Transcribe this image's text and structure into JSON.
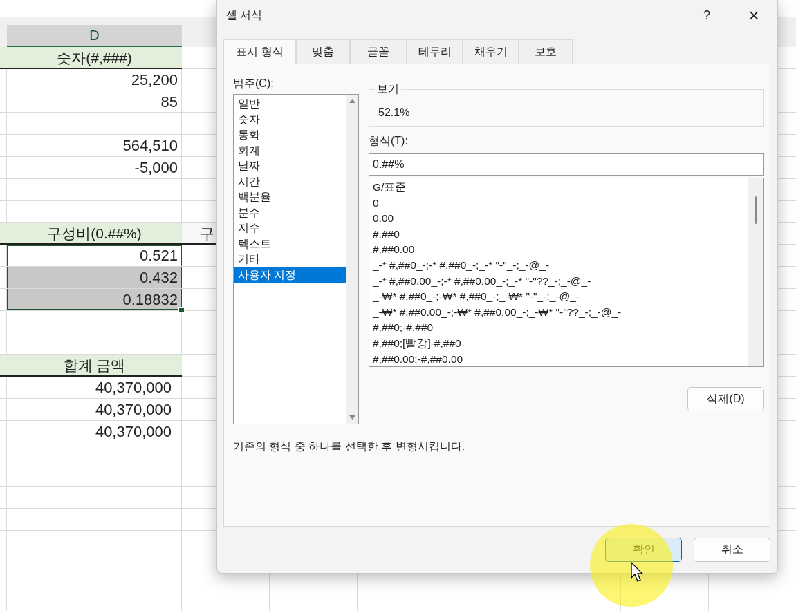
{
  "sheet": {
    "column_header": "D",
    "rows": [
      {
        "kind": "header",
        "d": "숫자(#,###)",
        "selected": false,
        "active": false
      },
      {
        "kind": "value",
        "d": "25,200",
        "selected": false,
        "active": false
      },
      {
        "kind": "value",
        "d": "85",
        "selected": false,
        "active": false
      },
      {
        "kind": "empty",
        "selected": false,
        "active": false
      },
      {
        "kind": "value",
        "d": "564,510",
        "selected": false,
        "active": false
      },
      {
        "kind": "value",
        "d": "-5,000",
        "selected": false,
        "active": false
      },
      {
        "kind": "empty",
        "selected": false,
        "active": false
      },
      {
        "kind": "empty",
        "selected": false,
        "active": false
      },
      {
        "kind": "header",
        "d": "구성비(0.##%)",
        "e": "구",
        "selected": false,
        "active": false
      },
      {
        "kind": "value",
        "d": "0.521",
        "selected": true,
        "active": true
      },
      {
        "kind": "value",
        "d": "0.432",
        "selected": true,
        "active": false
      },
      {
        "kind": "value",
        "d": "0.18832",
        "selected": true,
        "active": false
      },
      {
        "kind": "empty",
        "selected": false,
        "active": false
      },
      {
        "kind": "empty",
        "selected": false,
        "active": false
      },
      {
        "kind": "header",
        "d": "합계 금액",
        "selected": false,
        "active": false
      },
      {
        "kind": "total",
        "d": "40,370,000",
        "selected": false,
        "active": false
      },
      {
        "kind": "total",
        "d": "40,370,000",
        "selected": false,
        "active": false
      },
      {
        "kind": "total",
        "d": "40,370,000",
        "selected": false,
        "active": false
      }
    ]
  },
  "dialog": {
    "title": "셀 서식",
    "help": "?",
    "close": "×",
    "tabs": [
      {
        "label": "표시 형식",
        "selected": true
      },
      {
        "label": "맞춤",
        "selected": false
      },
      {
        "label": "글꼴",
        "selected": false
      },
      {
        "label": "테두리",
        "selected": false
      },
      {
        "label": "채우기",
        "selected": false
      },
      {
        "label": "보호",
        "selected": false
      }
    ],
    "category_label": "범주(C):",
    "categories": [
      {
        "label": "일반",
        "selected": false
      },
      {
        "label": "숫자",
        "selected": false
      },
      {
        "label": "통화",
        "selected": false
      },
      {
        "label": "회계",
        "selected": false
      },
      {
        "label": "날짜",
        "selected": false
      },
      {
        "label": "시간",
        "selected": false
      },
      {
        "label": "백분율",
        "selected": false
      },
      {
        "label": "분수",
        "selected": false
      },
      {
        "label": "지수",
        "selected": false
      },
      {
        "label": "텍스트",
        "selected": false
      },
      {
        "label": "기타",
        "selected": false
      },
      {
        "label": "사용자 지정",
        "selected": true
      }
    ],
    "preview": {
      "label": "보기",
      "value": "52.1%"
    },
    "format_label": "형식(T):",
    "format_value": "0.##%",
    "formats": [
      {
        "label": "G/표준",
        "selected": false
      },
      {
        "label": "0",
        "selected": false
      },
      {
        "label": "0.00",
        "selected": false
      },
      {
        "label": "#,##0",
        "selected": false
      },
      {
        "label": "#,##0.00",
        "selected": false
      },
      {
        "label": "_-* #,##0_-;-* #,##0_-;_-* \"-\"_-;_-@_-",
        "selected": false
      },
      {
        "label": "_-* #,##0.00_-;-* #,##0.00_-;_-* \"-\"??_-;_-@_-",
        "selected": false
      },
      {
        "label": "_-₩* #,##0_-;-₩* #,##0_-;_-₩* \"-\"_-;_-@_-",
        "selected": false
      },
      {
        "label": "_-₩* #,##0.00_-;-₩* #,##0.00_-;_-₩* \"-\"??_-;_-@_-",
        "selected": false
      },
      {
        "label": "#,##0;-#,##0",
        "selected": false
      },
      {
        "label": "#,##0;[빨강]-#,##0",
        "selected": false
      },
      {
        "label": "#,##0.00;-#,##0.00",
        "selected": false
      }
    ],
    "delete_button": "삭제(D)",
    "description": "기존의 형식 중 하나를 선택한 후 변형시킵니다.",
    "ok_button": "확인",
    "cancel_button": "취소"
  }
}
